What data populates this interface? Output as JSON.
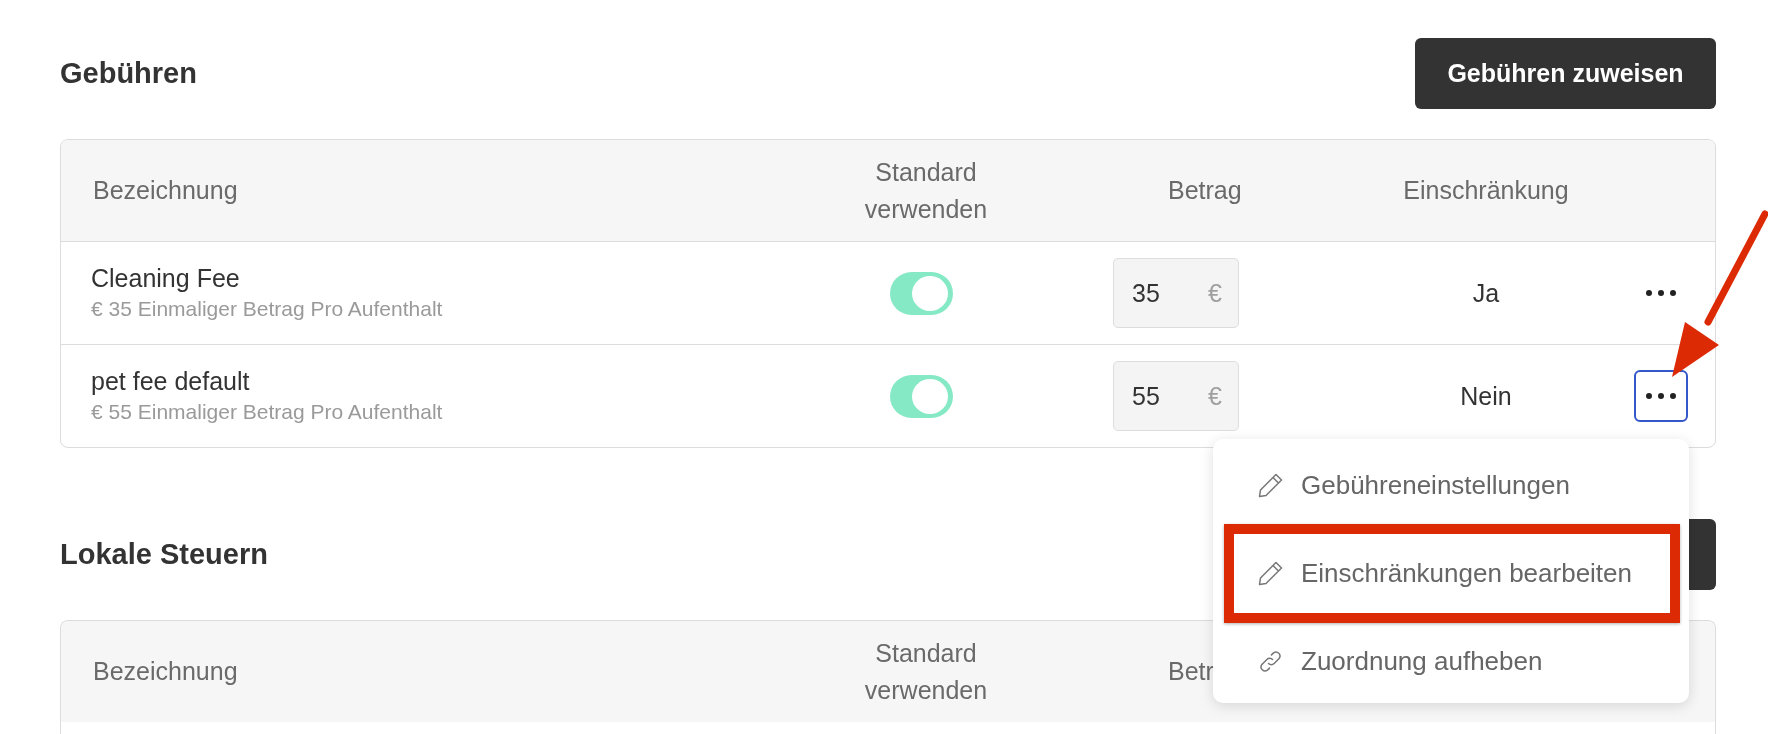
{
  "sections": [
    {
      "title": "Gebühren",
      "button": {
        "shown": true,
        "label": "Gebühren zuweisen"
      },
      "table": {
        "columns": [
          "Bezeichnung",
          "Standard verwenden",
          "Betrag",
          "Einschränkung"
        ],
        "rows": [
          {
            "name": "Cleaning Fee",
            "description": "€ 35 Einmaliger Betrag Pro Aufenthalt",
            "use_default": true,
            "amount": "35",
            "currency": "€",
            "restriction": "Ja",
            "menu_open": false,
            "arrow_pointer": false
          },
          {
            "name": "pet fee default",
            "description": "€ 55 Einmaliger Betrag Pro Aufenthalt",
            "use_default": true,
            "amount": "55",
            "currency": "€",
            "restriction": "Nein",
            "menu_open": true,
            "arrow_pointer": true
          }
        ]
      }
    },
    {
      "title": "Lokale Steuern",
      "button": {
        "shown": true
      },
      "table": {
        "columns": [
          "Bezeichnung",
          "Standard verwenden",
          "Betr"
        ]
      }
    }
  ],
  "menu": {
    "items": [
      {
        "kind": "edit",
        "label": "Gebühreneinstellungen",
        "highlighted": false
      },
      {
        "kind": "edit",
        "label": "Einschränkungen bearbeiten",
        "highlighted": true
      },
      {
        "kind": "unlink",
        "label": "Zuordnung aufheben",
        "highlighted": false
      }
    ]
  }
}
